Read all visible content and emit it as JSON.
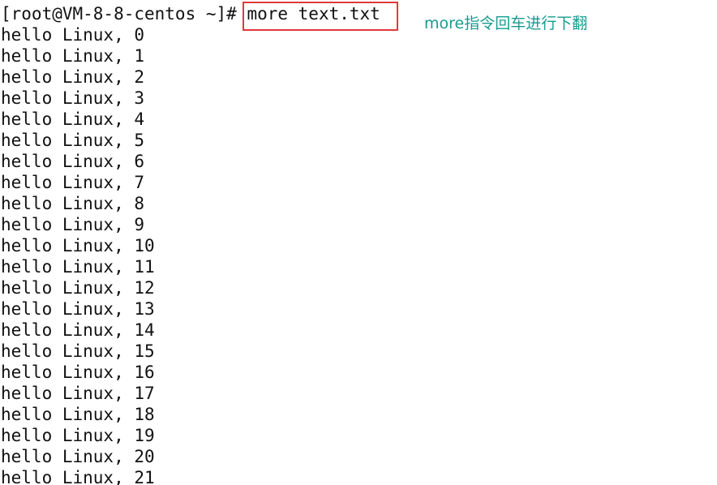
{
  "terminal": {
    "prompt": "[root@VM-8-8-centos ~]#",
    "command": "more text.txt",
    "output_lines": [
      "hello Linux, 0",
      "hello Linux, 1",
      "hello Linux, 2",
      "hello Linux, 3",
      "hello Linux, 4",
      "hello Linux, 5",
      "hello Linux, 6",
      "hello Linux, 7",
      "hello Linux, 8",
      "hello Linux, 9",
      "hello Linux, 10",
      "hello Linux, 11",
      "hello Linux, 12",
      "hello Linux, 13",
      "hello Linux, 14",
      "hello Linux, 15",
      "hello Linux, 16",
      "hello Linux, 17",
      "hello Linux, 18",
      "hello Linux, 19",
      "hello Linux, 20",
      "hello Linux, 21"
    ]
  },
  "annotation": {
    "text": "more指令回车进行下翻",
    "box_color": "#e0393b",
    "text_color": "#169c8f"
  }
}
